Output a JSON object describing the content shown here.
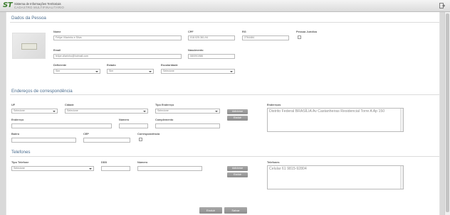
{
  "header": {
    "logo_mark": "ST",
    "logo_line1": "Sistema de Informações Territoriais",
    "logo_line2": "CADASTRO MULTIFINALITÁRIO",
    "logout_icon": "logout-icon"
  },
  "pessoa": {
    "title": "Dados da Pessoa",
    "photo_icon": "photo-placeholder-icon",
    "nome_label": "Nome",
    "nome_value": "Felipe Vilarinho e Silva",
    "cpf_label": "CPF",
    "cpf_value": "018.025.361-94",
    "rg_label": "RG",
    "rg_value": "2764484",
    "pj_label": "Pessoa Jurídica",
    "email_label": "Email",
    "email_value": "felipe.vilarinho@hotmail.com",
    "nascimento_label": "Nascimento",
    "nascimento_value": "08/09/1986",
    "deficiente_label": "Deficiente",
    "deficiente_value": "Sim",
    "estado_label": "Estado",
    "estado_value": "Sim",
    "escolaridade_label": "Escolaridade",
    "escolaridade_value": "Selecione"
  },
  "enderecos": {
    "title": "Endereços de correspondência",
    "uf_label": "UF",
    "uf_value": "Selecione",
    "cidade_label": "Cidade",
    "cidade_value": "Selecione",
    "tipo_label": "Tipo Endereço",
    "tipo_value": "Selecione",
    "adicionar": "Adicionar",
    "excluir": "Excluir",
    "list_label": "Endereços",
    "list_value": "Distrito Federal BRASÍLIA Av Castanheiras Residencial Torre A Ap 150",
    "endereco_label": "Endereço",
    "numero_label": "Número",
    "complemento_label": "Complemento",
    "bairro_label": "Bairro",
    "cep_label": "CEP",
    "corresp_label": "Correspondência"
  },
  "telefones": {
    "title": "Telefones",
    "tipo_label": "Tipo Telefone",
    "tipo_value": "Selecione",
    "ddd_label": "DDD",
    "numero_label": "Número",
    "adicionar": "Adicionar",
    "excluir": "Excluir",
    "list_label": "Telefones",
    "list_value": "Celular 61 9815-92804"
  },
  "footer": {
    "excluir": "Excluir",
    "salvar": "Salvar"
  }
}
